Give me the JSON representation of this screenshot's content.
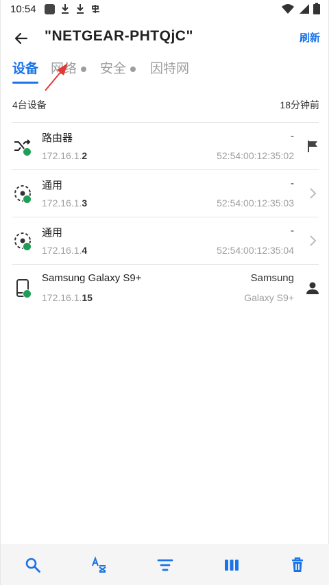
{
  "status_bar": {
    "time": "10:54",
    "icons": [
      "square-icon",
      "download-icon",
      "download-icon",
      "kb-icon",
      "wifi-icon",
      "signal-icon",
      "battery-icon"
    ]
  },
  "app_bar": {
    "title": "\"NETGEAR-PHTQjC\"",
    "refresh_label": "刷新"
  },
  "tabs": [
    {
      "label": "设备",
      "active": true
    },
    {
      "label": "网络",
      "dot": true
    },
    {
      "label": "安全",
      "dot": true
    },
    {
      "label": "因特网"
    }
  ],
  "summary": {
    "device_count": "4台设备",
    "updated": "18分钟前"
  },
  "devices": [
    {
      "name": "路由器",
      "ip_prefix": "172.16.1.",
      "ip_suffix": "2",
      "right_top": "-",
      "right_bottom": "52:54:00:12:35:02",
      "icon": "router-shuffle-icon",
      "trail": "flag-icon"
    },
    {
      "name": "通用",
      "ip_prefix": "172.16.1.",
      "ip_suffix": "3",
      "right_top": "-",
      "right_bottom": "52:54:00:12:35:03",
      "icon": "generic-device-icon",
      "trail": "chevron-right-icon"
    },
    {
      "name": "通用",
      "ip_prefix": "172.16.1.",
      "ip_suffix": "4",
      "right_top": "-",
      "right_bottom": "52:54:00:12:35:04",
      "icon": "generic-device-icon",
      "trail": "chevron-right-icon"
    },
    {
      "name": "Samsung Galaxy S9+",
      "ip_prefix": "172.16.1.",
      "ip_suffix": "15",
      "right_top": "Samsung",
      "right_bottom": "Galaxy S9+",
      "icon": "phone-icon",
      "trail": "person-icon"
    }
  ],
  "bottom_bar": [
    "search-icon",
    "sort-az-icon",
    "filter-icon",
    "columns-icon",
    "delete-icon"
  ],
  "colors": {
    "accent": "#1a73e8",
    "online": "#1e9e57",
    "annotation": "#e53935"
  }
}
